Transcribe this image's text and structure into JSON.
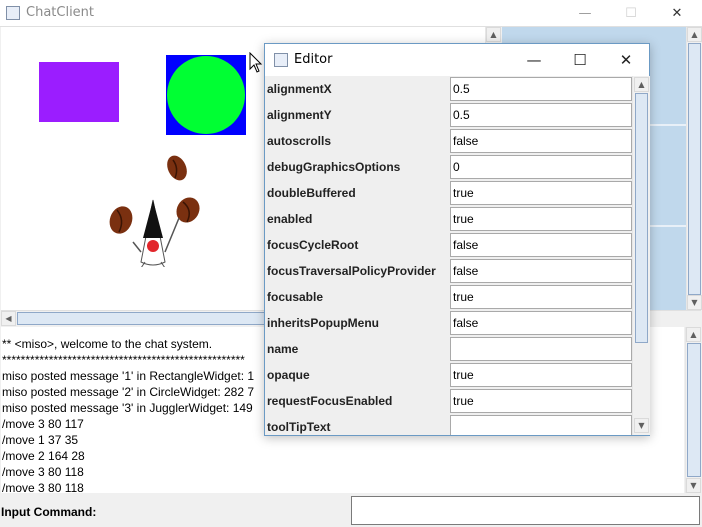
{
  "window": {
    "title": "ChatClient",
    "minimize_glyph": "—",
    "maximize_glyph": "☐",
    "close_glyph": "✕"
  },
  "widgets": {
    "rectangle_color": "#9b1dff",
    "circle_color": "#00ff33",
    "circle_bg_color": "#0000ff"
  },
  "log": {
    "lines": [
      "** <miso>, welcome to the chat system.",
      "****************************************************",
      "miso posted message '1' in RectangleWidget: 1",
      "miso posted message '2' in CircleWidget: 282 7",
      "miso posted message '3' in JugglerWidget: 149",
      "/move 3 80 117",
      "/move 1 37 35",
      "/move 2 164 28",
      "/move 3 80 118",
      "/move 3 80 118"
    ]
  },
  "input": {
    "label": "Input Command:",
    "value": ""
  },
  "editor": {
    "title": "Editor",
    "minimize_glyph": "—",
    "maximize_glyph": "☐",
    "close_glyph": "✕",
    "properties": [
      {
        "name": "alignmentX",
        "value": "0.5"
      },
      {
        "name": "alignmentY",
        "value": "0.5"
      },
      {
        "name": "autoscrolls",
        "value": "false"
      },
      {
        "name": "debugGraphicsOptions",
        "value": "0"
      },
      {
        "name": "doubleBuffered",
        "value": "true"
      },
      {
        "name": "enabled",
        "value": "true"
      },
      {
        "name": "focusCycleRoot",
        "value": "false"
      },
      {
        "name": "focusTraversalPolicyProvider",
        "value": "false"
      },
      {
        "name": "focusable",
        "value": "true"
      },
      {
        "name": "inheritsPopupMenu",
        "value": "false"
      },
      {
        "name": "name",
        "value": ""
      },
      {
        "name": "opaque",
        "value": "true"
      },
      {
        "name": "requestFocusEnabled",
        "value": "true"
      },
      {
        "name": "toolTipText",
        "value": ""
      }
    ]
  }
}
